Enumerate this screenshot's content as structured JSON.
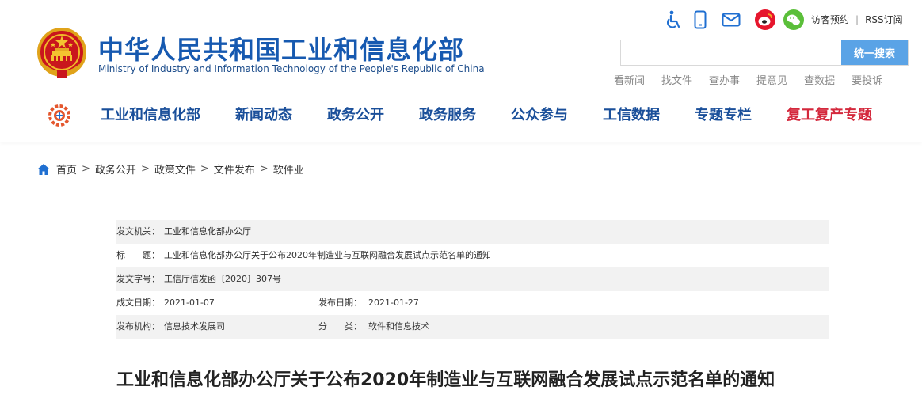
{
  "site": {
    "title": "中华人民共和国工业和信息化部",
    "subtitle": "Ministry of Industry and Information Technology of the People's Republic of China"
  },
  "top_bar": {
    "icons": [
      "accessibility-icon",
      "mobile-icon",
      "mail-icon",
      "weibo-icon",
      "wechat-icon"
    ],
    "links": [
      "访客预约",
      "RSS订阅"
    ]
  },
  "search": {
    "value": "",
    "placeholder": "",
    "button_label": "统一搜索"
  },
  "quick_links": [
    "看新闻",
    "找文件",
    "查办事",
    "提意见",
    "查数据",
    "要投诉"
  ],
  "nav": {
    "items": [
      "工业和信息化部",
      "新闻动态",
      "政务公开",
      "政务服务",
      "公众参与",
      "工信数据",
      "专题专栏",
      "复工复产专题"
    ],
    "highlight_color": "#d4283c",
    "color": "#1a4f9a"
  },
  "breadcrumb": [
    "首页",
    "政务公开",
    "政策文件",
    "文件发布",
    "软件业"
  ],
  "meta": {
    "issuer_label": "发文机关：",
    "issuer": "工业和信息化部办公厅",
    "title_label": "标　　题：",
    "title": "工业和信息化部办公厅关于公布2020年制造业与互联网融合发展试点示范名单的通知",
    "doc_no_label": "发文字号：",
    "doc_no": "工信厅信发函〔2020〕307号",
    "created_label": "成文日期：",
    "created": "2021-01-07",
    "published_label": "发布日期：",
    "published": "2021-01-27",
    "org_label": "发布机构：",
    "org": "信息技术发展司",
    "category_label": "分　　类：",
    "category": "软件和信息技术"
  },
  "document": {
    "title": "工业和信息化部办公厅关于公布2020年制造业与互联网融合发展试点示范名单的通知"
  }
}
